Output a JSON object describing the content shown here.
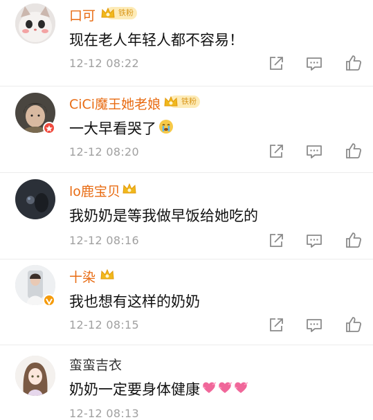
{
  "comments": [
    {
      "username": "口可",
      "fan_badge": "铁粉",
      "text": "现在老人年轻人都不容易！",
      "time": "12-12 08:22"
    },
    {
      "username": "CiCi魔王她老娘",
      "fan_badge": "铁粉",
      "text": "一大早看哭了",
      "time": "12-12 08:20"
    },
    {
      "username": "lo鹿宝贝",
      "text": "我奶奶是等我做早饭给她吃的",
      "time": "12-12 08:16"
    },
    {
      "username": "十染",
      "text": "我也想有这样的奶奶",
      "time": "12-12 08:15"
    },
    {
      "username": "蛮蛮吉衣",
      "text": "奶奶一定要身体健康",
      "time": "12-12 08:13"
    }
  ],
  "icons": {
    "share": "share-icon",
    "reply": "comment-icon",
    "like": "like-icon",
    "crown": "crown-icon",
    "crying_emoji": "crying-emoji-icon",
    "heart_emoji": "heart-emoji-icon"
  },
  "colors": {
    "username_vip": "#e86b12",
    "time_gray": "#a0a0a0",
    "fan_badge_bg": "#fdebb7"
  }
}
